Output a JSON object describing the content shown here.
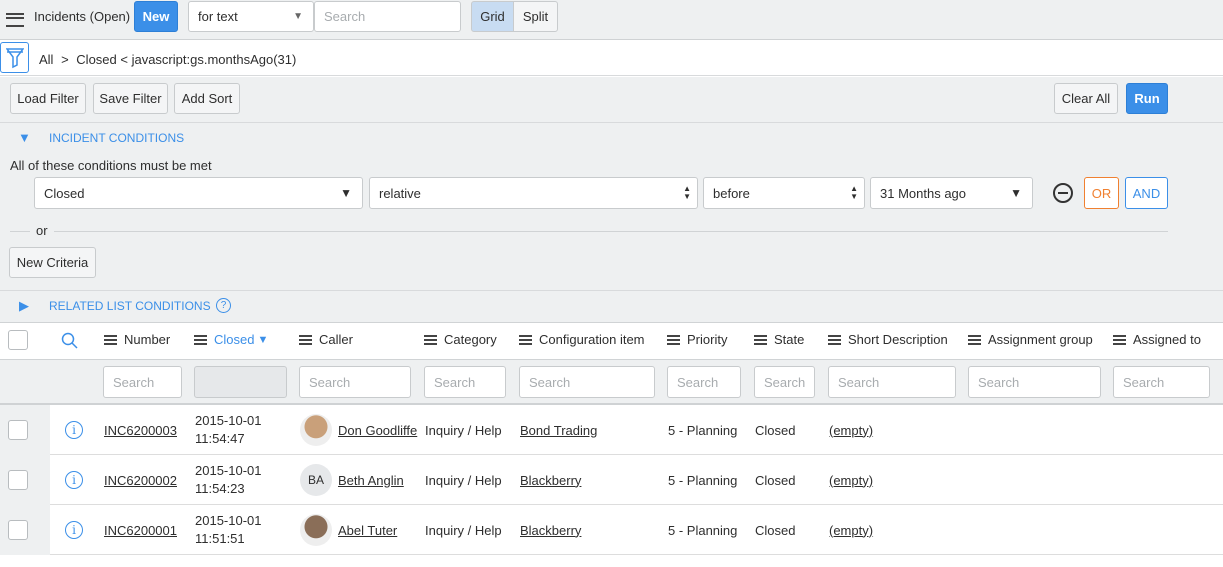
{
  "header": {
    "title": "Incidents (Open)",
    "new_label": "New",
    "search_field": "for text",
    "search_placeholder": "Search",
    "grid_label": "Grid",
    "split_label": "Split"
  },
  "breadcrumb": {
    "all": "All",
    "sep": ">",
    "condition": "Closed < javascript:gs.monthsAgo(31)"
  },
  "filter_toolbar": {
    "load": "Load Filter",
    "save": "Save Filter",
    "add_sort": "Add Sort",
    "clear_all": "Clear All",
    "run": "Run"
  },
  "conditions": {
    "title": "INCIDENT CONDITIONS",
    "subtitle": "All of these conditions must be met",
    "field": "Closed",
    "operator": "relative",
    "relation": "before",
    "value": "31 Months ago",
    "or_label": "OR",
    "and_label": "AND",
    "or_separator": "or",
    "new_criteria": "New Criteria",
    "related_title": "RELATED LIST CONDITIONS",
    "help": "?"
  },
  "table": {
    "columns": [
      "Number",
      "Closed",
      "Caller",
      "Category",
      "Configuration item",
      "Priority",
      "State",
      "Short Description",
      "Assignment group",
      "Assigned to"
    ],
    "search_placeholder": "Search",
    "rows": [
      {
        "number": "INC6200003",
        "date": "2015-10-01",
        "time": "11:54:47",
        "caller": "Don Goodliffe",
        "initials": "",
        "category": "Inquiry / Help",
        "ci": "Bond Trading",
        "priority": "5 - Planning",
        "state": "Closed",
        "short_description": "(empty)"
      },
      {
        "number": "INC6200002",
        "date": "2015-10-01",
        "time": "11:54:23",
        "caller": "Beth Anglin",
        "initials": "BA",
        "category": "Inquiry / Help",
        "ci": "Blackberry",
        "priority": "5 - Planning",
        "state": "Closed",
        "short_description": "(empty)"
      },
      {
        "number": "INC6200001",
        "date": "2015-10-01",
        "time": "11:51:51",
        "caller": "Abel Tuter",
        "initials": "",
        "category": "Inquiry / Help",
        "ci": "Blackberry",
        "priority": "5 - Planning",
        "state": "Closed",
        "short_description": "(empty)"
      }
    ]
  },
  "colors": {
    "accent": "#3b8fe8",
    "or": "#f08030"
  }
}
